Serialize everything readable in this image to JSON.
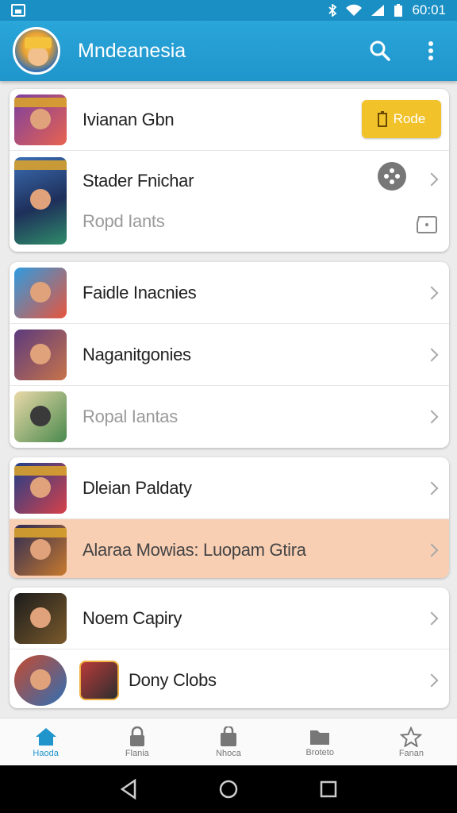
{
  "status": {
    "time": "60:01"
  },
  "appbar": {
    "title": "Mndeanesia",
    "accent": "#1f95cc"
  },
  "card1": {
    "row1": {
      "label": "Ivianan Gbn",
      "action_label": "Rode"
    },
    "row2": {
      "label": "Stader Fnichar",
      "sublabel": "Ropd Iants"
    }
  },
  "card2": {
    "rows": [
      {
        "label": "Faidle Inacnies"
      },
      {
        "label": "Naganitgonies"
      },
      {
        "label": "Ropal Iantas"
      }
    ]
  },
  "card3": {
    "rows": [
      {
        "label": "Dleian Paldaty"
      },
      {
        "label": "Alaraa Mowias: Luopam Gtira"
      }
    ],
    "highlight_color": "#f9cfb4"
  },
  "card4": {
    "rows": [
      {
        "label": "Noem Capiry"
      },
      {
        "label": "Dony Clobs"
      }
    ]
  },
  "bottom_nav": [
    {
      "label": "Haoda",
      "icon": "home-icon",
      "active": true
    },
    {
      "label": "Flania",
      "icon": "lock-icon"
    },
    {
      "label": "Nhoca",
      "icon": "bag-icon"
    },
    {
      "label": "Broteto",
      "icon": "folder-icon"
    },
    {
      "label": "Fanan",
      "icon": "star-icon"
    }
  ]
}
